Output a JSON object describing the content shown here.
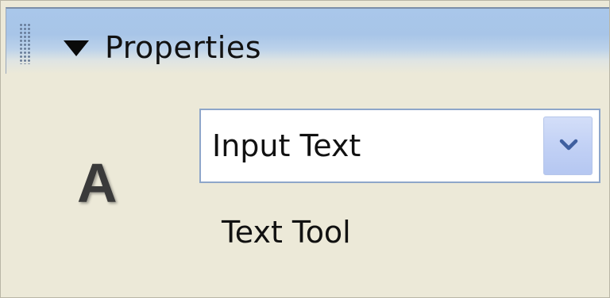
{
  "panel": {
    "title": "Properties"
  },
  "tool": {
    "icon": "text-tool-icon",
    "glyph": "A",
    "name": "Text Tool"
  },
  "text_type_select": {
    "selected": "Input Text"
  },
  "colors": {
    "titlebar": "#a9c7ea",
    "panel_background": "#ece9d8",
    "select_border": "#8ea6c9",
    "select_button": "#c2d1f5",
    "chevron": "#3f5f9f"
  }
}
